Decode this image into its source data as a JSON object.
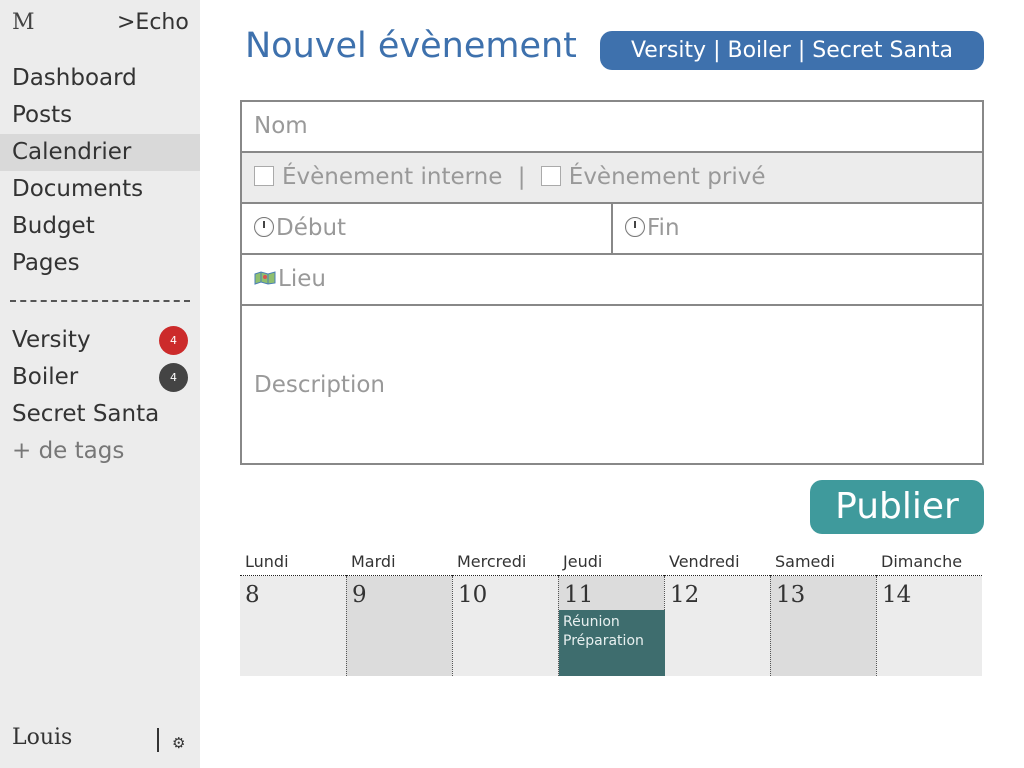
{
  "app": {
    "logo": "M",
    "brand": ">Echo"
  },
  "sidebar": {
    "nav": [
      "Dashboard",
      "Posts",
      "Calendrier",
      "Documents",
      "Budget",
      "Pages"
    ],
    "active_nav": "Calendrier",
    "tags": [
      {
        "label": "Versity",
        "badge": "4",
        "badge_color": "#cc2b2b"
      },
      {
        "label": "Boiler",
        "badge": "4",
        "badge_color": "#444444"
      },
      {
        "label": "Secret Santa"
      }
    ],
    "more_tags": "+ de tags",
    "user": "Louis",
    "settings_icon": "gear-icon"
  },
  "header": {
    "title": "Nouvel évènement",
    "tags_pill": "Versity | Boiler | Secret Santa"
  },
  "form": {
    "name_placeholder": "Nom",
    "internal_label": "Évènement interne",
    "separator": "|",
    "private_label": "Évènement privé",
    "start_placeholder": "Début",
    "end_placeholder": "Fin",
    "location_placeholder": "Lieu",
    "description_placeholder": "Description",
    "icons": {
      "start": "clock-icon",
      "end": "clock-icon",
      "location": "map-icon"
    }
  },
  "publish_label": "Publier",
  "calendar": {
    "days": [
      {
        "name": "Lundi",
        "date": "8",
        "bg": "#ececec"
      },
      {
        "name": "Mardi",
        "date": "9",
        "bg": "#dcdcdc"
      },
      {
        "name": "Mercredi",
        "date": "10",
        "bg": "#ececec"
      },
      {
        "name": "Jeudi",
        "date": "11",
        "bg": "#dcdcdc"
      },
      {
        "name": "Vendredi",
        "date": "12",
        "bg": "#ececec"
      },
      {
        "name": "Samedi",
        "date": "13",
        "bg": "#dcdcdc"
      },
      {
        "name": "Dimanche",
        "date": "14",
        "bg": "#ececec"
      }
    ],
    "event": {
      "day": "Jeudi",
      "line1": "Réunion",
      "line2": "Préparation"
    }
  },
  "colors": {
    "accent": "#3e71ad",
    "publish": "#3f9a9c",
    "event": "#3e6d6e"
  }
}
